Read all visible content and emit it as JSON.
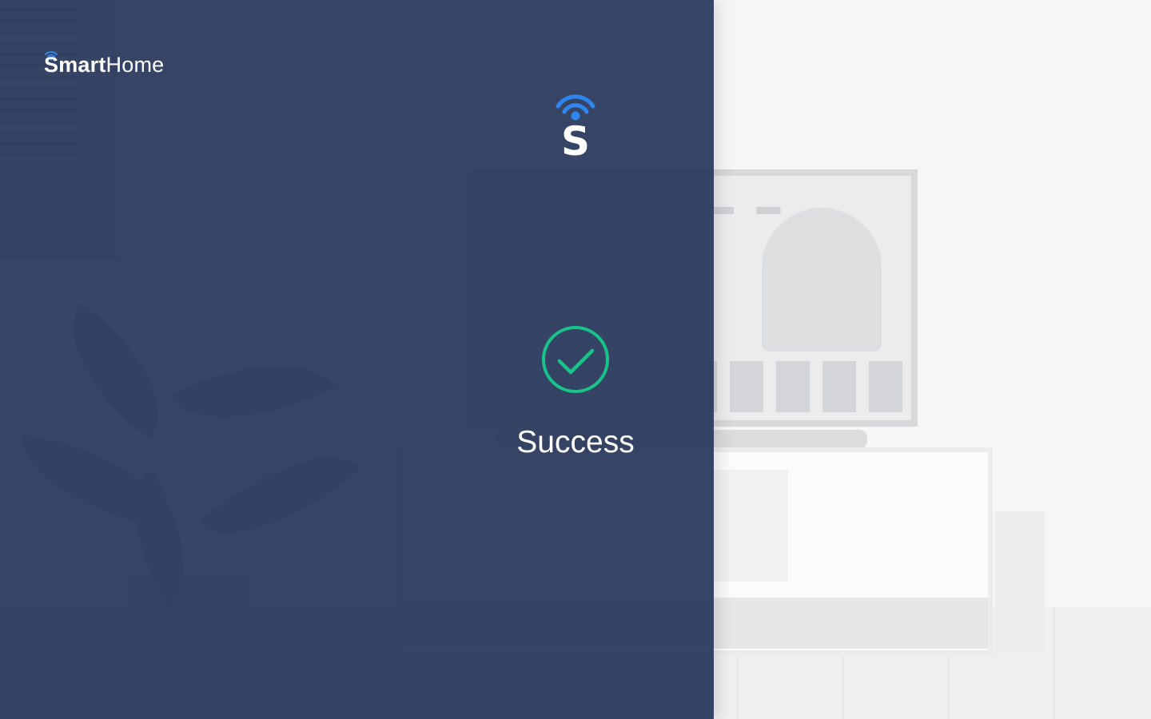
{
  "brand": {
    "name_bold": "Smart",
    "name_light": "Home",
    "icon": "wifi-signal-icon"
  },
  "app_logo": {
    "letter": "S",
    "icon": "wifi-signal-icon",
    "accent_color": "#2f86ee",
    "letter_color": "#ffffff"
  },
  "status": {
    "icon": "check-circle-icon",
    "icon_color": "#19c48a",
    "message": "Success"
  },
  "colors": {
    "panel_overlay": "#29395b",
    "text": "#ffffff"
  }
}
